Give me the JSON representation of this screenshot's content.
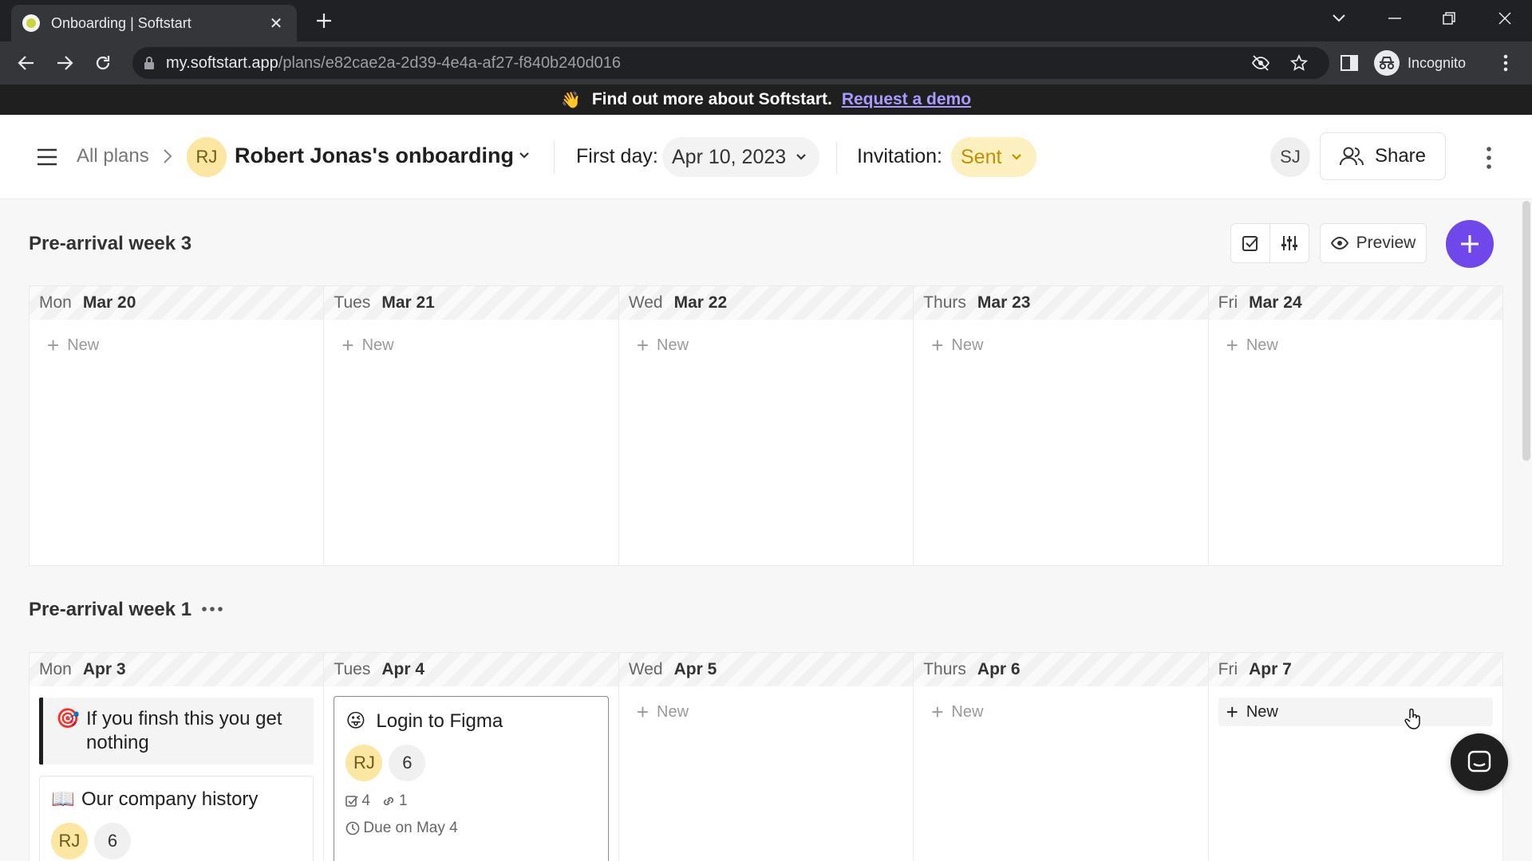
{
  "browser": {
    "tab_title": "Onboarding | Softstart",
    "url_host": "my.softstart.app",
    "url_path": "/plans/e82cae2a-2d39-4e4a-af27-f840b240d016",
    "profile_label": "Incognito"
  },
  "banner": {
    "emoji": "👋",
    "text": "Find out more about Softstart.",
    "link": "Request a demo"
  },
  "header": {
    "all_plans": "All plans",
    "plan_avatar": "RJ",
    "plan_title": "Robert Jonas's onboarding",
    "first_day_label": "First day:",
    "first_day_value": "Apr 10, 2023",
    "invitation_label": "Invitation:",
    "invitation_value": "Sent",
    "user_avatar": "SJ",
    "share_label": "Share"
  },
  "toolbar": {
    "preview_label": "Preview"
  },
  "sections": [
    {
      "title": "Pre-arrival week 3",
      "days": [
        {
          "name": "Mon",
          "date": "Mar 20",
          "new_label": "New"
        },
        {
          "name": "Tues",
          "date": "Mar 21",
          "new_label": "New"
        },
        {
          "name": "Wed",
          "date": "Mar 22",
          "new_label": "New"
        },
        {
          "name": "Thurs",
          "date": "Mar 23",
          "new_label": "New"
        },
        {
          "name": "Fri",
          "date": "Mar 24",
          "new_label": "New"
        }
      ]
    },
    {
      "title": "Pre-arrival week 1",
      "days": [
        {
          "name": "Mon",
          "date": "Apr 3"
        },
        {
          "name": "Tues",
          "date": "Apr 4"
        },
        {
          "name": "Wed",
          "date": "Apr 5",
          "new_label": "New"
        },
        {
          "name": "Thurs",
          "date": "Apr 6",
          "new_label": "New"
        },
        {
          "name": "Fri",
          "date": "Apr 7",
          "new_label": "New"
        }
      ],
      "cards": {
        "milestone": {
          "emoji": "🎯",
          "title": "If you finsh this you get nothing"
        },
        "history": {
          "emoji": "📖",
          "title": "Our company history",
          "avatar": "RJ",
          "count": "6"
        },
        "figma": {
          "emoji": "😜",
          "title": "Login to Figma",
          "avatar": "RJ",
          "count": "6",
          "checks": "4",
          "links": "1",
          "due": "Due on May 4"
        }
      }
    }
  ],
  "colors": {
    "accent": "#7047eb",
    "invitation_bg": "#fdf0c0",
    "invitation_text": "#c28f00",
    "avatar_bg": "#fbe7a1",
    "banner_bg": "#1f1f1f"
  }
}
